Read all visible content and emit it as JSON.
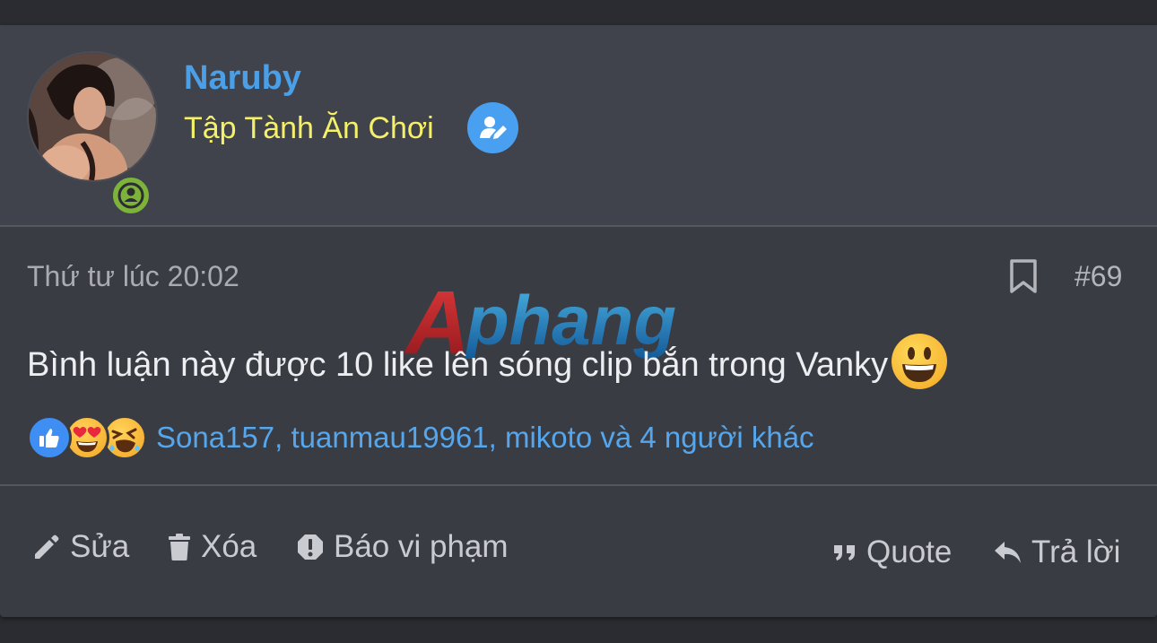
{
  "user": {
    "name": "Naruby",
    "title": "Tập Tành Ăn Chơi",
    "avatar_icon": "user-avatar-photo",
    "status_icon": "online-user-icon",
    "badge_icon": "user-edit-icon"
  },
  "post": {
    "time": "Thứ tư lúc 20:02",
    "number": "#69",
    "content": "Bình luận này được 10 like lên sóng clip bắn trong Vanky",
    "watermark": "Aphang"
  },
  "reactions": {
    "icons": [
      "thumbs-up-icon",
      "heart-eyes-icon",
      "laughing-icon"
    ],
    "reactors": "Sona157, tuanmau19961, mikoto và 4 người khác"
  },
  "actions": {
    "edit": "Sửa",
    "delete": "Xóa",
    "report": "Báo vi phạm",
    "quote": "Quote",
    "reply": "Trả lời"
  },
  "colors": {
    "username": "#4a9fe6",
    "title": "#f4f06a",
    "link": "#55a6ec",
    "online": "#7db33b"
  }
}
